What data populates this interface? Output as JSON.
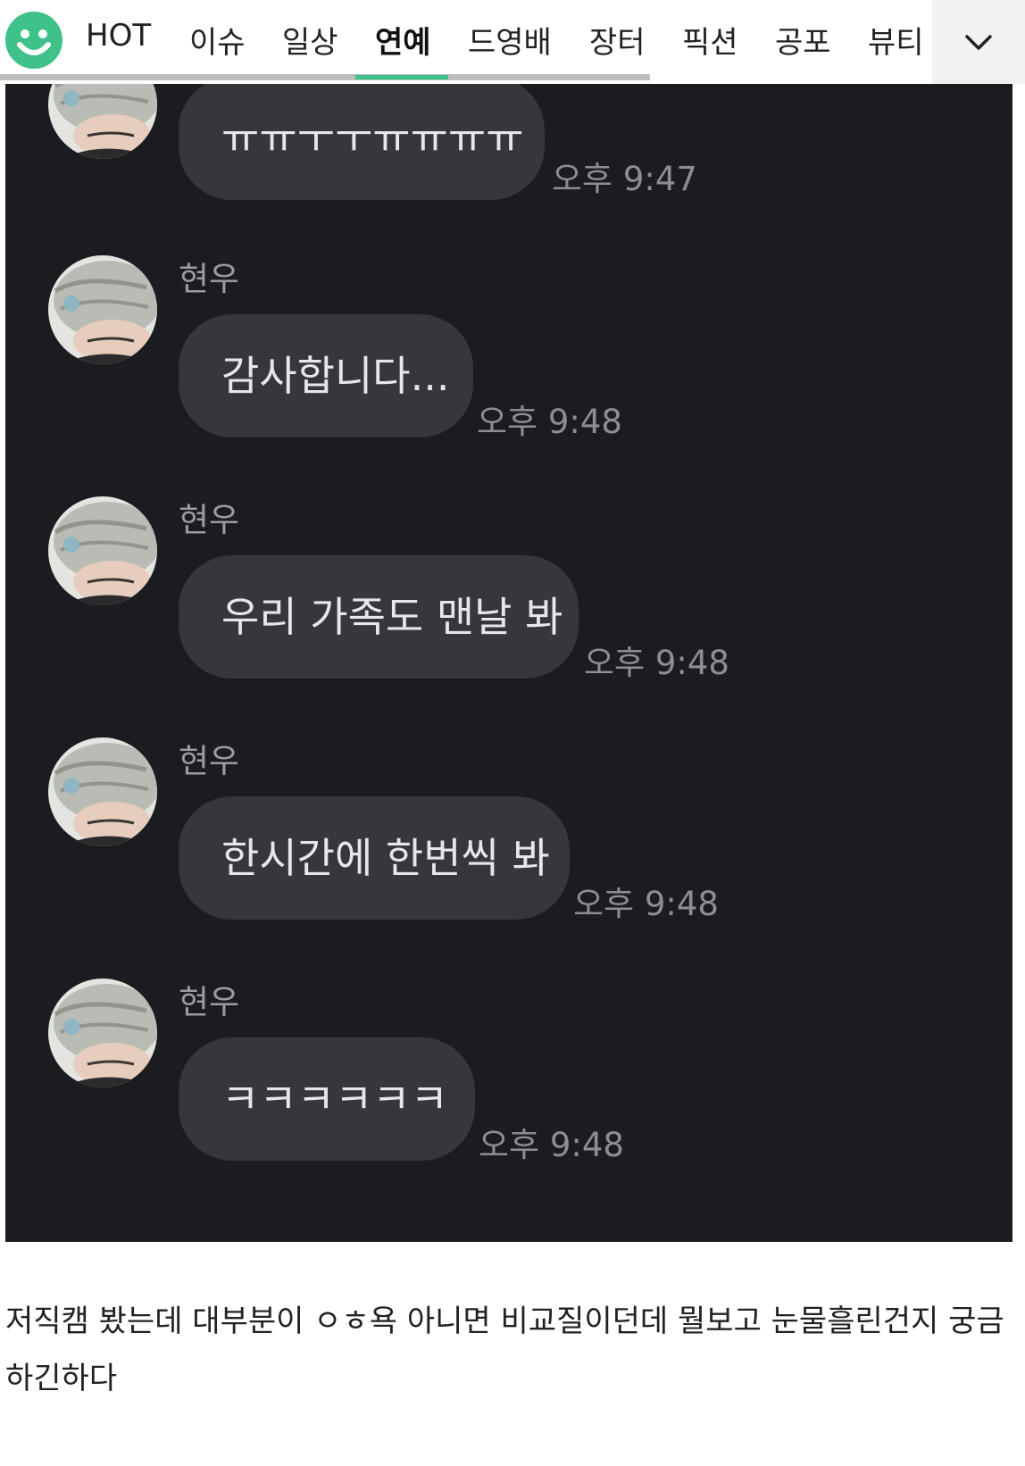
{
  "nav": {
    "tabs": [
      {
        "label": "HOT",
        "active": false
      },
      {
        "label": "이슈",
        "active": false
      },
      {
        "label": "일상",
        "active": false
      },
      {
        "label": "연예",
        "active": true
      },
      {
        "label": "드영배",
        "active": false
      },
      {
        "label": "장터",
        "active": false
      },
      {
        "label": "픽션",
        "active": false
      },
      {
        "label": "공포",
        "active": false
      },
      {
        "label": "뷰티",
        "active": false
      }
    ],
    "logo_icon": "smiley-face-icon",
    "more_icon": "chevron-down-icon",
    "accent_color": "#3ec28a"
  },
  "chat": {
    "background_color": "#1b1c20",
    "bubble_color": "#35373d",
    "messages": [
      {
        "sender": "",
        "text": "ㅠㅠㅜㅜㅠㅠㅠㅠ",
        "time": "오후 9:47"
      },
      {
        "sender": "현우",
        "text": "감사합니다...",
        "time": "오후 9:48"
      },
      {
        "sender": "현우",
        "text": "우리 가족도 맨날 봐",
        "time": "오후 9:48"
      },
      {
        "sender": "현우",
        "text": "한시간에 한번씩 봐",
        "time": "오후 9:48"
      },
      {
        "sender": "현우",
        "text": "ㅋㅋㅋㅋㅋㅋ",
        "time": "오후 9:48"
      }
    ]
  },
  "post": {
    "caption": "저직캠 봤는데 대부분이 ㅇㅎ욕 아니면 비교질이던데 뭘보고 눈물흘린건지 궁금하긴하다"
  }
}
